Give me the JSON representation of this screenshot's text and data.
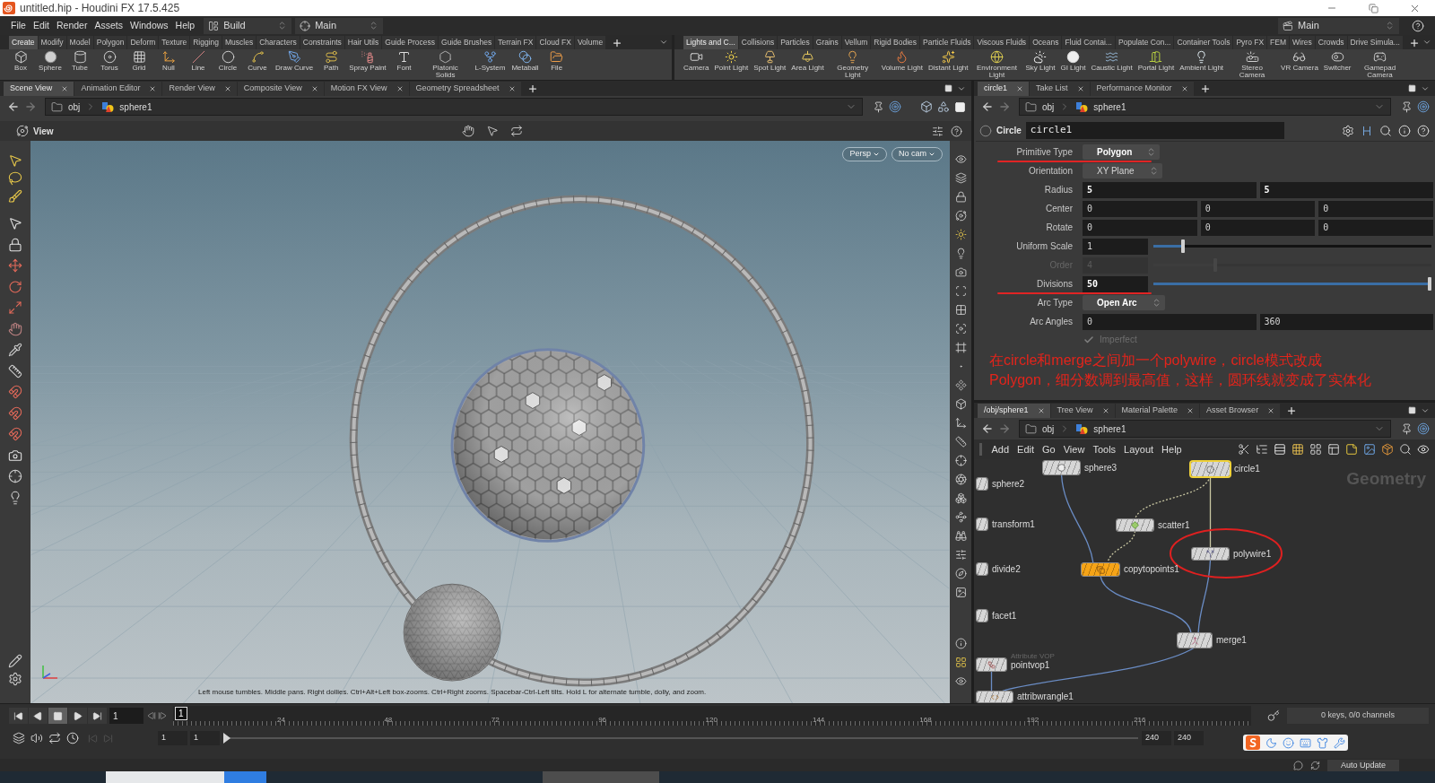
{
  "window": {
    "title": "untitled.hip - Houdini FX 17.5.425"
  },
  "menu_bar": {
    "items": [
      "File",
      "Edit",
      "Render",
      "Assets",
      "Windows",
      "Help"
    ],
    "desktop": "Build",
    "network_context": "Main",
    "desktop_right": "Main"
  },
  "shelf_left": {
    "tabs": [
      {
        "label": "Create",
        "selected": true
      },
      {
        "label": "Modify",
        "selected": false
      },
      {
        "label": "Model",
        "selected": false
      },
      {
        "label": "Polygon",
        "selected": false
      },
      {
        "label": "Deform",
        "selected": false
      },
      {
        "label": "Texture",
        "selected": false
      },
      {
        "label": "Rigging",
        "selected": false
      },
      {
        "label": "Muscles",
        "selected": false
      },
      {
        "label": "Characters",
        "selected": false
      },
      {
        "label": "Constraints",
        "selected": false
      },
      {
        "label": "Hair Utils",
        "selected": false
      },
      {
        "label": "Guide Process",
        "selected": false
      },
      {
        "label": "Guide Brushes",
        "selected": false
      },
      {
        "label": "Terrain FX",
        "selected": false
      },
      {
        "label": "Cloud FX",
        "selected": false
      },
      {
        "label": "Volume",
        "selected": false
      }
    ],
    "tools": [
      "Box",
      "Sphere",
      "Tube",
      "Torus",
      "Grid",
      "Null",
      "Line",
      "Circle",
      "Curve",
      "Draw Curve",
      "Path",
      "Spray Paint",
      "Font",
      "Platonic Solids",
      "L-System",
      "Metaball",
      "File"
    ]
  },
  "shelf_right": {
    "tabs": [
      {
        "label": "Lights and C...",
        "selected": true
      },
      {
        "label": "Collisions",
        "selected": false
      },
      {
        "label": "Particles",
        "selected": false
      },
      {
        "label": "Grains",
        "selected": false
      },
      {
        "label": "Vellum",
        "selected": false
      },
      {
        "label": "Rigid Bodies",
        "selected": false
      },
      {
        "label": "Particle Fluids",
        "selected": false
      },
      {
        "label": "Viscous Fluids",
        "selected": false
      },
      {
        "label": "Oceans",
        "selected": false
      },
      {
        "label": "Fluid Contai...",
        "selected": false
      },
      {
        "label": "Populate Con...",
        "selected": false
      },
      {
        "label": "Container Tools",
        "selected": false
      },
      {
        "label": "Pyro FX",
        "selected": false
      },
      {
        "label": "FEM",
        "selected": false
      },
      {
        "label": "Wires",
        "selected": false
      },
      {
        "label": "Crowds",
        "selected": false
      },
      {
        "label": "Drive Simula...",
        "selected": false
      }
    ],
    "tools": [
      "Camera",
      "Point Light",
      "Spot Light",
      "Area Light",
      "Geometry Light",
      "Volume Light",
      "Distant Light",
      "Environment Light",
      "Sky Light",
      "GI Light",
      "Caustic Light",
      "Portal Light",
      "Ambient Light",
      "Stereo Camera",
      "VR Camera",
      "Switcher",
      "Gamepad Camera"
    ]
  },
  "scene_pane": {
    "tabs": [
      {
        "label": "Scene View",
        "selected": true
      },
      {
        "label": "Animation Editor",
        "selected": false
      },
      {
        "label": "Render View",
        "selected": false
      },
      {
        "label": "Composite View",
        "selected": false
      },
      {
        "label": "Motion FX View",
        "selected": false
      },
      {
        "label": "Geometry Spreadsheet",
        "selected": false
      }
    ],
    "path": [
      "obj",
      "sphere1"
    ],
    "toolbar_label": "View",
    "camera_menus": [
      "Persp",
      "No cam"
    ],
    "hint": "Left mouse tumbles. Middle pans. Right dollies. Ctrl+Alt+Left box-zooms. Ctrl+Right zooms. Spacebar-Ctrl-Left tilts. Hold L for alternate tumble, dolly, and zoom."
  },
  "parameter_pane": {
    "tabs": [
      {
        "label": "circle1",
        "selected": true
      },
      {
        "label": "Take List",
        "selected": false
      },
      {
        "label": "Performance Monitor",
        "selected": false
      }
    ],
    "path": [
      "obj",
      "sphere1"
    ],
    "node_type": "Circle",
    "node_name": "circle1",
    "parameters": [
      {
        "kind": "menu",
        "label": "Primitive Type",
        "value": "Polygon",
        "changed": true,
        "disabled": false,
        "underlined": true
      },
      {
        "kind": "menu",
        "label": "Orientation",
        "value": "XY Plane",
        "changed": false,
        "disabled": false,
        "underlined": false
      },
      {
        "kind": "vector",
        "label": "Radius",
        "values": [
          "5",
          "5"
        ],
        "changed": true,
        "disabled": false,
        "underlined": false
      },
      {
        "kind": "vector",
        "label": "Center",
        "values": [
          "0",
          "0",
          "0"
        ],
        "changed": false,
        "disabled": false,
        "underlined": false
      },
      {
        "kind": "vector",
        "label": "Rotate",
        "values": [
          "0",
          "0",
          "0"
        ],
        "changed": false,
        "disabled": false,
        "underlined": false
      },
      {
        "kind": "slider",
        "label": "Uniform Scale",
        "value": "1",
        "level": 0.1,
        "changed": false,
        "disabled": false,
        "underlined": false
      },
      {
        "kind": "slider",
        "label": "Order",
        "value": "4",
        "level": 0.22,
        "changed": false,
        "disabled": true,
        "underlined": false
      },
      {
        "kind": "slider",
        "label": "Divisions",
        "value": "50",
        "level": 1,
        "changed": true,
        "disabled": false,
        "underlined": true
      },
      {
        "kind": "menu",
        "label": "Arc Type",
        "value": "Open Arc",
        "changed": true,
        "disabled": false,
        "underlined": false
      },
      {
        "kind": "vector",
        "label": "Arc Angles",
        "values": [
          "0",
          "360"
        ],
        "changed": false,
        "disabled": false,
        "underlined": false
      },
      {
        "kind": "toggle",
        "label": "Imperfect",
        "checked": true,
        "changed": false,
        "disabled": true,
        "underlined": false
      }
    ]
  },
  "annotation": {
    "lines": [
      "在circle和merge之间加一个polywire，circle模式改成",
      "Polygon，细分数调到最高值，这样，圆环线就变成了实体化"
    ]
  },
  "network_pane": {
    "tabs": [
      {
        "label": "/obj/sphere1",
        "selected": true
      },
      {
        "label": "Tree View",
        "selected": false
      },
      {
        "label": "Material Palette",
        "selected": false
      },
      {
        "label": "Asset Browser",
        "selected": false
      }
    ],
    "path": [
      "obj",
      "sphere1"
    ],
    "menus": [
      "Add",
      "Edit",
      "Go",
      "View",
      "Tools",
      "Layout",
      "Help"
    ],
    "context_label": "Geometry",
    "nodes": [
      {
        "name": "sphere3",
        "selected": false,
        "circled": false,
        "color": "#d6d6d6"
      },
      {
        "name": "circle1",
        "selected": true,
        "circled": false,
        "color": "#d6d6d6"
      },
      {
        "name": "sphere2",
        "selected": false,
        "circled": false,
        "color": "#d6d6d6"
      },
      {
        "name": "transform1",
        "selected": false,
        "circled": false,
        "color": "#d6d6d6"
      },
      {
        "name": "scatter1",
        "selected": false,
        "circled": false,
        "color": "#d6d6d6"
      },
      {
        "name": "polywire1",
        "selected": false,
        "circled": true,
        "color": "#d6d6d6"
      },
      {
        "name": "divide2",
        "selected": false,
        "circled": false,
        "color": "#d6d6d6"
      },
      {
        "name": "copytopoints1",
        "selected": false,
        "circled": false,
        "color": "#f6a417"
      },
      {
        "name": "facet1",
        "selected": false,
        "circled": false,
        "color": "#d6d6d6"
      },
      {
        "name": "merge1",
        "selected": false,
        "circled": false,
        "color": "#d6d6d6"
      },
      {
        "name": "pointvop1",
        "type_label": "Attribute VOP",
        "selected": false,
        "circled": false,
        "color": "#d6d6d6"
      },
      {
        "name": "attribwrangle1",
        "selected": false,
        "circled": false,
        "color": "#d6d6d6"
      }
    ]
  },
  "timeline": {
    "stopped": true,
    "current_frame": "1",
    "frame_marker": "1",
    "ruler_labels": [
      "24",
      "48",
      "72",
      "96",
      "120",
      "144",
      "168",
      "192",
      "216"
    ],
    "keys_info": "0 keys, 0/0 channels",
    "range_start": [
      "1",
      "1"
    ],
    "range_end": [
      "240",
      "240"
    ],
    "update_mode": "Auto Update"
  }
}
